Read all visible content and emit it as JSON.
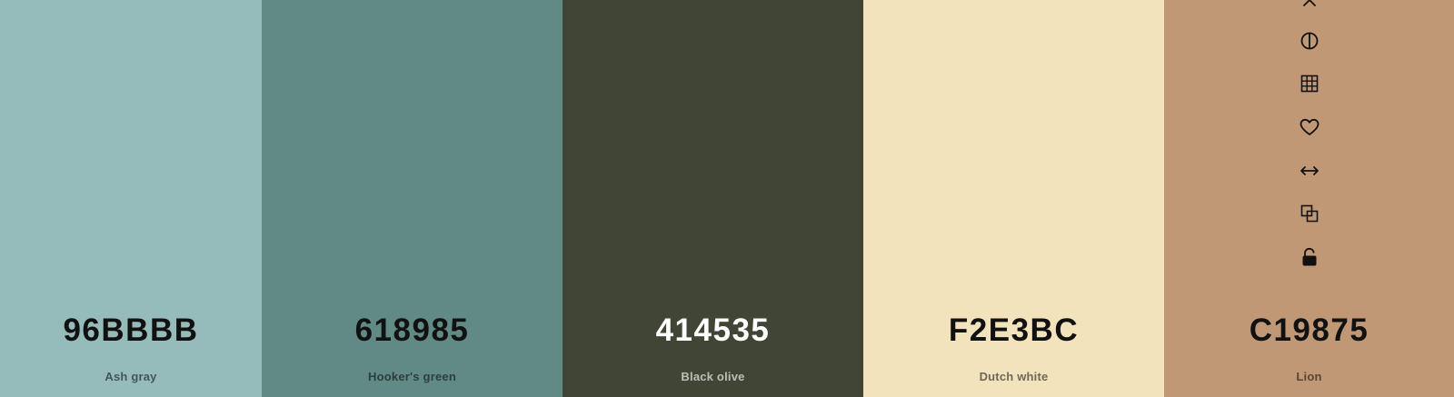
{
  "palette": [
    {
      "hex": "96BBBB",
      "name": "Ash gray",
      "color": "#96BBBB",
      "text_theme": "dark"
    },
    {
      "hex": "618985",
      "name": "Hooker's green",
      "color": "#618985",
      "text_theme": "dark"
    },
    {
      "hex": "414535",
      "name": "Black olive",
      "color": "#414535",
      "text_theme": "light"
    },
    {
      "hex": "F2E3BC",
      "name": "Dutch white",
      "color": "#F2E3BC",
      "text_theme": "dark"
    },
    {
      "hex": "C19875",
      "name": "Lion",
      "color": "#C19875",
      "text_theme": "dark"
    }
  ],
  "toolbar_icons": [
    "close-icon",
    "contrast-icon",
    "grid-icon",
    "heart-icon",
    "drag-arrows-icon",
    "copy-icon",
    "unlock-icon"
  ]
}
